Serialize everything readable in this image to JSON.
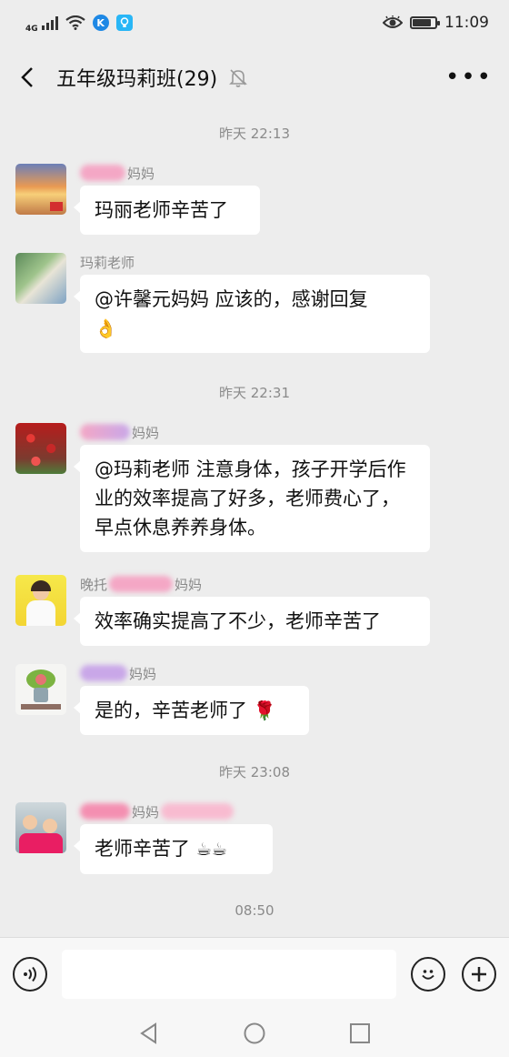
{
  "status_bar": {
    "network": "4G",
    "app_icon_1": "K",
    "time": "11:09",
    "battery_level": 0.85
  },
  "header": {
    "title": "五年级玛莉班(29)"
  },
  "timestamps": [
    "昨天 22:13",
    "昨天 22:31",
    "昨天 23:08",
    "08:50"
  ],
  "messages": [
    {
      "sender_visible": "妈妈",
      "text": "玛丽老师辛苦了"
    },
    {
      "sender_visible": "玛莉老师",
      "text": "@许馨元妈妈  应该的，感谢回复",
      "emoji": "👌"
    },
    {
      "sender_visible": "妈妈",
      "text": "@玛莉老师  注意身体，孩子开学后作业的效率提高了好多，老师费心了，早点休息养养身体。"
    },
    {
      "sender_prefix": "晚托",
      "sender_visible": "妈妈",
      "text": "效率确实提高了不少，老师辛苦了"
    },
    {
      "sender_visible": "妈妈",
      "text": "是的，辛苦老师了",
      "emoji": "🌹"
    },
    {
      "sender_visible": "妈妈",
      "text": "老师辛苦了",
      "emoji": "☕☕"
    }
  ],
  "colors": {
    "background": "#ededed",
    "bubble": "#ffffff",
    "timestamp": "#8a8a8a"
  }
}
